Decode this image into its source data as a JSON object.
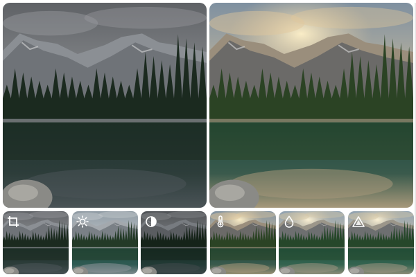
{
  "editor": {
    "panels": [
      {
        "name": "before-photo",
        "tone": "muted"
      },
      {
        "name": "after-photo",
        "tone": "warm"
      }
    ],
    "tools": [
      {
        "id": "crop",
        "icon": "crop-icon",
        "tone": "muted"
      },
      {
        "id": "brightness",
        "icon": "sun-icon",
        "tone": "cool"
      },
      {
        "id": "contrast",
        "icon": "contrast-icon",
        "tone": "dark"
      },
      {
        "id": "temperature",
        "icon": "thermometer-icon",
        "tone": "warm"
      },
      {
        "id": "saturation",
        "icon": "droplet-icon",
        "tone": "vivid"
      },
      {
        "id": "sharpen",
        "icon": "triangle-icon",
        "tone": "vivid"
      }
    ]
  },
  "colors": {
    "icon": "#ffffff",
    "sky_muted": "#7b7d80",
    "sky_warm": "#c8b08a",
    "forest": "#1f3323",
    "water": "#1c3b36"
  }
}
